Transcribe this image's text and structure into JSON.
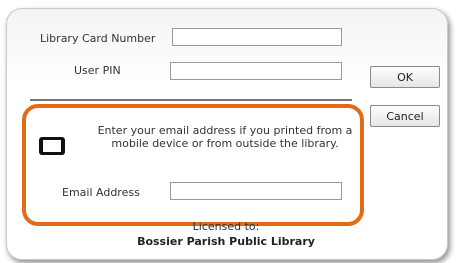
{
  "login": {
    "card_number_label": "Library Card Number",
    "card_number_value": "",
    "pin_label": "User PIN",
    "pin_value": ""
  },
  "buttons": {
    "ok_label": "OK",
    "cancel_label": "Cancel"
  },
  "email_section": {
    "message": "Enter your email address if you printed from a mobile device or from outside the library.",
    "email_label": "Email Address",
    "email_value": ""
  },
  "footer": {
    "licensed_label": "Licensed to:",
    "licensee": "Bossier Parish Public Library"
  },
  "colors": {
    "highlight": "#e46b15"
  },
  "icons": {
    "device": "mobile-device-icon"
  }
}
